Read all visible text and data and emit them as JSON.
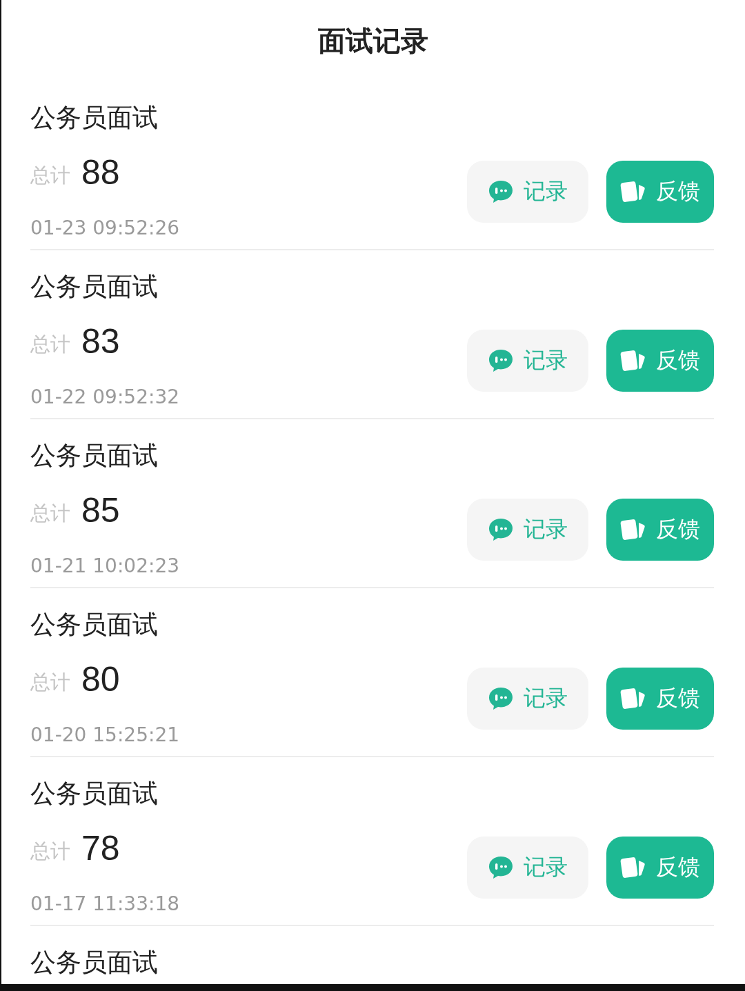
{
  "header": {
    "title": "面试记录"
  },
  "records": [
    {
      "title": "公务员面试",
      "total_label": "总计",
      "score": "88",
      "time": "01-23 09:52:26",
      "record_button": "记录",
      "feedback_button": "反馈"
    },
    {
      "title": "公务员面试",
      "total_label": "总计",
      "score": "83",
      "time": "01-22 09:52:32",
      "record_button": "记录",
      "feedback_button": "反馈"
    },
    {
      "title": "公务员面试",
      "total_label": "总计",
      "score": "85",
      "time": "01-21 10:02:23",
      "record_button": "记录",
      "feedback_button": "反馈"
    },
    {
      "title": "公务员面试",
      "total_label": "总计",
      "score": "80",
      "time": "01-20 15:25:21",
      "record_button": "记录",
      "feedback_button": "反馈"
    },
    {
      "title": "公务员面试",
      "total_label": "总计",
      "score": "78",
      "time": "01-17 11:33:18",
      "record_button": "记录",
      "feedback_button": "反馈"
    },
    {
      "title": "公务员面试"
    }
  ]
}
